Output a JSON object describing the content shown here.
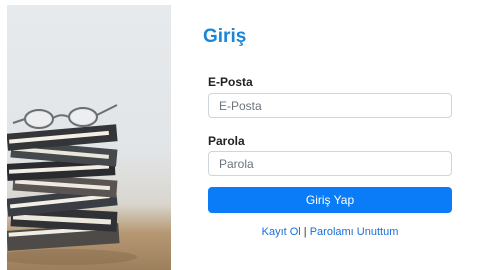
{
  "login": {
    "title": "Giriş",
    "email": {
      "label": "E-Posta",
      "placeholder": "E-Posta"
    },
    "password": {
      "label": "Parola",
      "placeholder": "Parola"
    },
    "submit_label": "Giriş Yap",
    "links": {
      "register": "Kayıt Ol",
      "separator": "|",
      "forgot_password": "Parolamı Unuttum"
    }
  },
  "colors": {
    "title": "#1a86d9",
    "button": "#0a7cf8",
    "link": "#1a6fd6"
  }
}
